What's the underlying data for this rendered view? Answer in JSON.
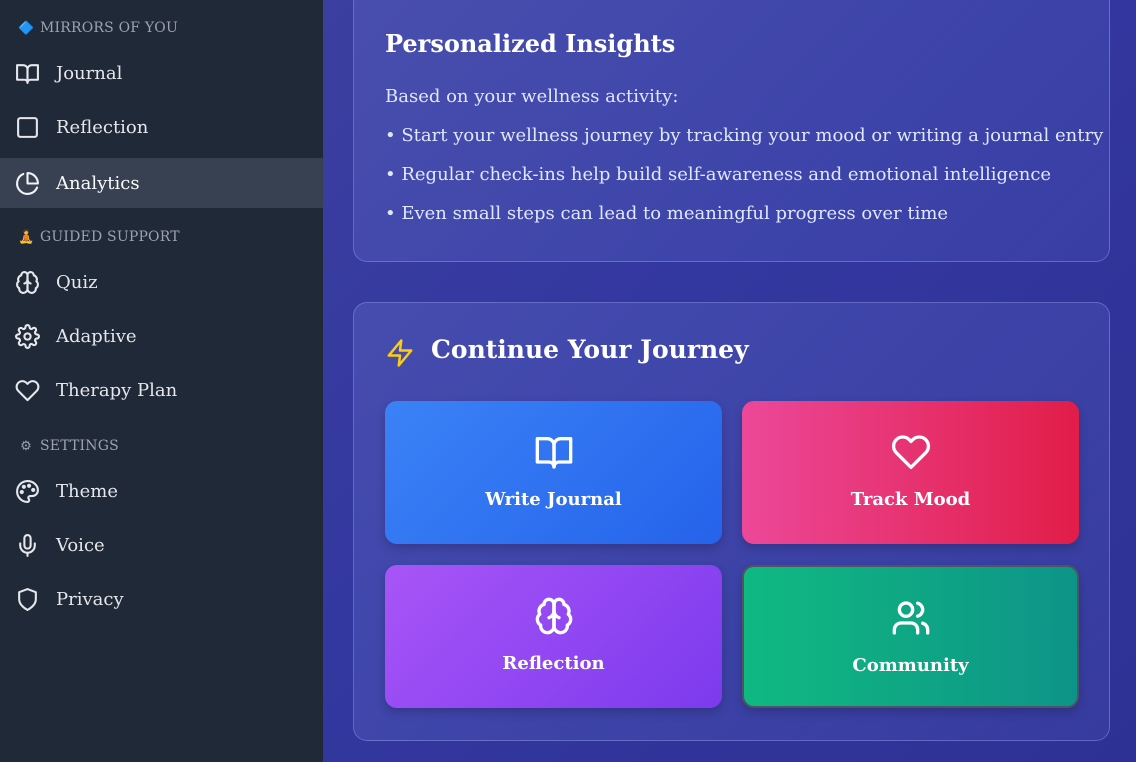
{
  "sidebar": {
    "sections": [
      {
        "icon": "diamond-icon",
        "emoji": "🔷",
        "label": "MIRRORS OF YOU"
      },
      {
        "icon": "meditation-icon",
        "emoji": "🧘",
        "label": "GUIDED SUPPORT"
      },
      {
        "icon": "gear-icon",
        "emoji": "⚙",
        "label": "SETTINGS"
      }
    ],
    "items": [
      {
        "label": "Journal",
        "icon": "book-open-icon"
      },
      {
        "label": "Reflection",
        "icon": "square-icon"
      },
      {
        "label": "Analytics",
        "icon": "pie-chart-icon",
        "active": true
      },
      {
        "label": "Quiz",
        "icon": "brain-icon"
      },
      {
        "label": "Adaptive",
        "icon": "settings-icon"
      },
      {
        "label": "Therapy Plan",
        "icon": "heart-icon"
      },
      {
        "label": "Theme",
        "icon": "palette-icon"
      },
      {
        "label": "Voice",
        "icon": "microphone-icon"
      },
      {
        "label": "Privacy",
        "icon": "shield-icon"
      }
    ]
  },
  "insights": {
    "title": "Personalized Insights",
    "intro": "Based on your wellness activity:",
    "lines": [
      "• Start your wellness journey by tracking your mood or writing a journal entry",
      "• Regular check-ins help build self-awareness and emotional intelligence",
      "• Even small steps can lead to meaningful progress over time"
    ]
  },
  "journey": {
    "title": "Continue Your Journey",
    "tiles": [
      {
        "label": "Write Journal",
        "icon": "book-open-icon"
      },
      {
        "label": "Track Mood",
        "icon": "heart-icon"
      },
      {
        "label": "Reflection",
        "icon": "brain-icon"
      },
      {
        "label": "Community",
        "icon": "users-icon"
      }
    ]
  },
  "colors": {
    "sidebar_bg": "#1f2937",
    "active_item_bg": "#374151",
    "main_bg": "#3338a0",
    "bolt": "#facc15"
  }
}
